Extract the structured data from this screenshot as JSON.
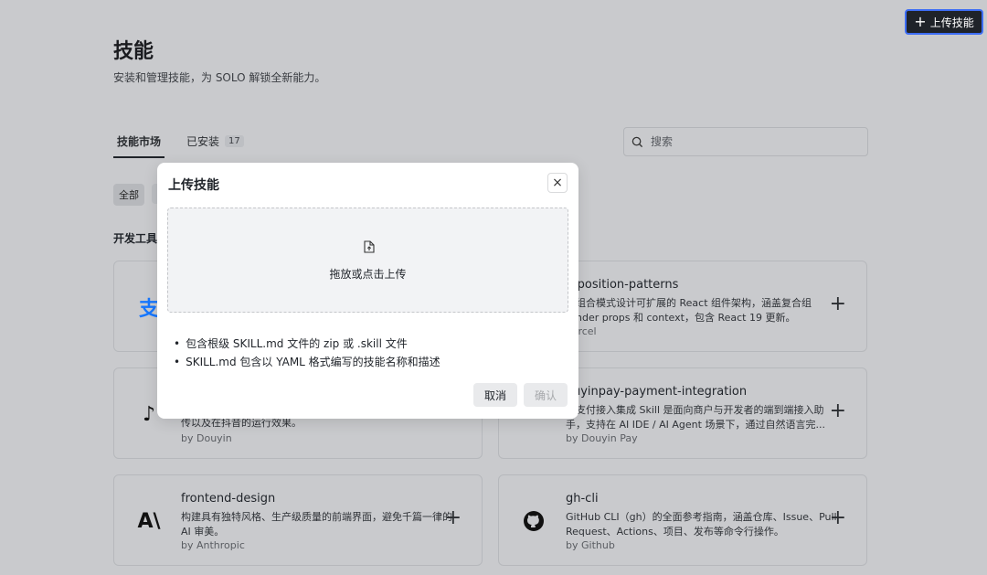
{
  "header": {
    "upload_button": "上传技能",
    "title": "技能",
    "subtitle": "安装和管理技能，为 SOLO 解锁全新能力。"
  },
  "tabs": [
    {
      "label": "技能市场",
      "active": true
    },
    {
      "label": "已安装",
      "count": "17"
    }
  ],
  "search": {
    "placeholder": "搜索"
  },
  "filter": {
    "all_label": "全部"
  },
  "section": {
    "title": "开发工具"
  },
  "cards": [
    {
      "logo": "支",
      "name": "",
      "desc": "",
      "by": ""
    },
    {
      "logo": "",
      "name": "mposition-patterns",
      "desc": "用组合模式设计可扩展的 React 组件架构，涵盖复合组　　render props 和 context，包含 React 19 更新。",
      "by": "Vercel"
    },
    {
      "logo": "♪",
      "name": "",
      "desc": "传以及在抖音的运行效果。",
      "by": "by Douyin"
    },
    {
      "logo": "",
      "name": "ouyinpay-payment-integration",
      "desc": "音支付接入集成 Skill 是面向商户与开发者的端到端接入助手，支持在 AI IDE / AI Agent 场景下，通过自然语言完...",
      "by": "by Douyin Pay"
    },
    {
      "logo": "A\\",
      "name": "frontend-design",
      "desc": "构建具有独特风格、生产级质量的前端界面，避免千篇一律的 AI 审美。",
      "by": "by Anthropic"
    },
    {
      "logo": "",
      "name": "gh-cli",
      "desc": "GitHub CLI（gh）的全面参考指南，涵盖仓库、Issue、Pull Request、Actions、项目、发布等命令行操作。",
      "by": "by Github"
    }
  ],
  "modal": {
    "title": "上传技能",
    "close": "×",
    "dropzone_text": "拖放或点击上传",
    "notes": [
      "包含根级 SKILL.md 文件的 zip 或 .skill 文件",
      "SKILL.md 包含以 YAML 格式编写的技能名称和描述"
    ],
    "cancel": "取消",
    "confirm": "确认"
  }
}
